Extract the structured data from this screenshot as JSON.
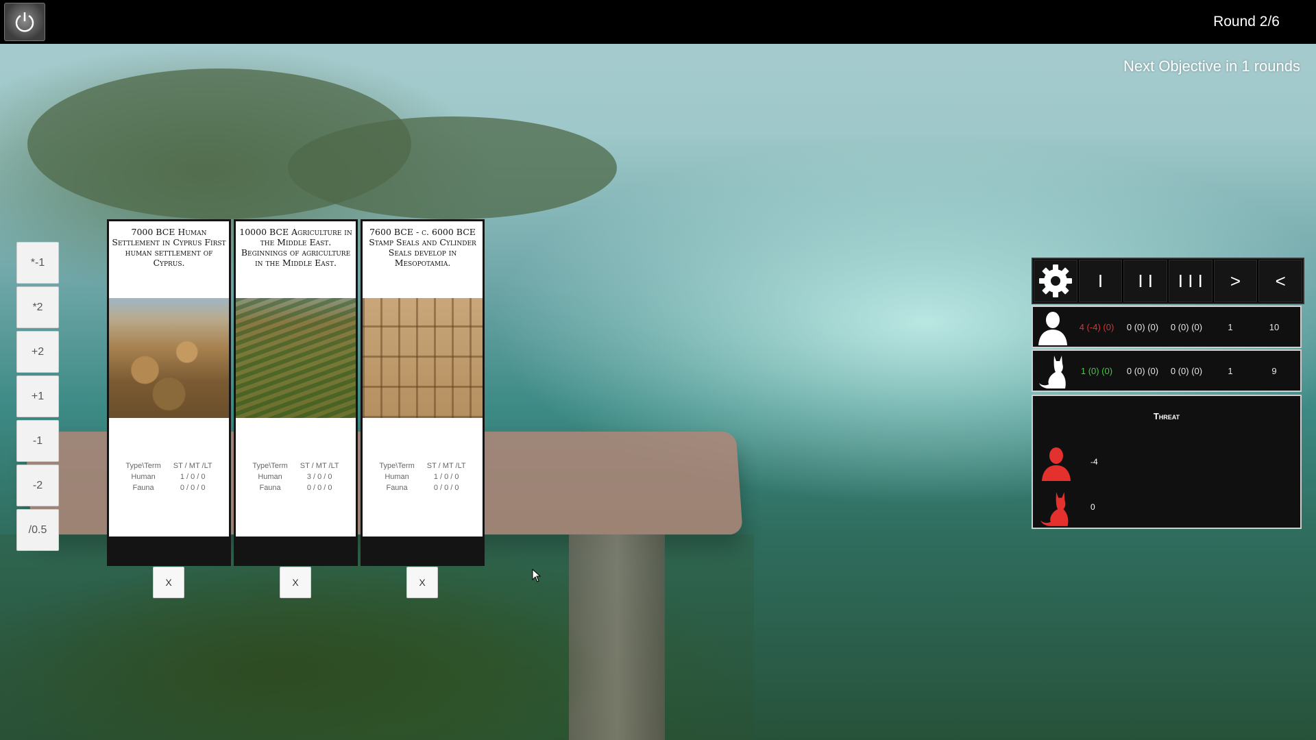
{
  "header": {
    "round": "Round 2/6"
  },
  "objective": "Next Objective in 1 rounds",
  "modifiers": [
    "*-1",
    "*2",
    "+2",
    "+1",
    "-1",
    "-2",
    "/0.5"
  ],
  "cards": [
    {
      "title": "7000 BCE Human Settlement in Cyprus First human settlement of Cyprus.",
      "image": "village-settlement",
      "stats": {
        "header": [
          "Type\\Term",
          "ST / MT /LT"
        ],
        "human": [
          "Human",
          "1 / 0 / 0"
        ],
        "fauna": [
          "Fauna",
          "0 / 0 / 0"
        ]
      },
      "remove_label": "X"
    },
    {
      "title": "10000 BCE Agriculture in the Middle East. Beginnings of agriculture in the Middle East.",
      "image": "terraced-fields",
      "stats": {
        "header": [
          "Type\\Term",
          "ST / MT /LT"
        ],
        "human": [
          "Human",
          "3 / 0 / 0"
        ],
        "fauna": [
          "Fauna",
          "0 / 0 / 0"
        ]
      },
      "remove_label": "X"
    },
    {
      "title": "7600 BCE - c. 6000 BCE Stamp Seals and Cylinder Seals develop in Mesopotamia.",
      "image": "carved-seals",
      "stats": {
        "header": [
          "Type\\Term",
          "ST / MT /LT"
        ],
        "human": [
          "Human",
          "1 / 0 / 0"
        ],
        "fauna": [
          "Fauna",
          "0 / 0 / 0"
        ]
      },
      "remove_label": "X"
    }
  ],
  "toolbar": {
    "icon": "gear-icon",
    "buttons": [
      "I",
      "I I",
      "I I I",
      ">",
      "<"
    ]
  },
  "stats": {
    "human": {
      "icon": "human-icon",
      "values": [
        "4 (-4) (0)",
        "0 (0) (0)",
        "0 (0) (0)",
        "1",
        "10"
      ]
    },
    "fauna": {
      "icon": "cat-icon",
      "values": [
        "1 (0) (0)",
        "0 (0) (0)",
        "0 (0) (0)",
        "1",
        "9"
      ]
    }
  },
  "threat": {
    "title": "Threat",
    "human_value": "-4",
    "fauna_value": "0",
    "color": "#e4312e"
  }
}
